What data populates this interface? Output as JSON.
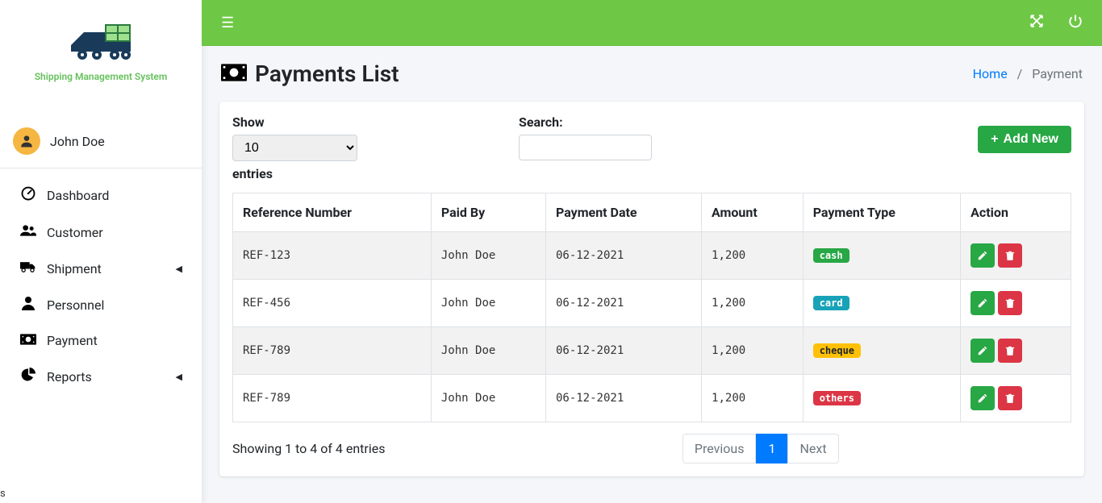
{
  "app": {
    "name": "Shipping Management System"
  },
  "user": {
    "name": "John Doe"
  },
  "sidebar": {
    "items": [
      {
        "label": "Dashboard",
        "icon": "dashboard-icon"
      },
      {
        "label": "Customer",
        "icon": "users-icon"
      },
      {
        "label": "Shipment",
        "icon": "truck-icon",
        "chevron": true
      },
      {
        "label": "Personnel",
        "icon": "user-icon"
      },
      {
        "label": "Payment",
        "icon": "money-icon"
      },
      {
        "label": "Reports",
        "icon": "chart-icon",
        "chevron": true
      }
    ]
  },
  "page": {
    "title": "Payments List"
  },
  "breadcrumb": {
    "home": "Home",
    "current": "Payment"
  },
  "datatable": {
    "show_label": "Show",
    "entries_label": "entries",
    "show_value": "10",
    "search_label": "Search:",
    "add_label": "Add New",
    "headers": [
      "Reference Number",
      "Paid By",
      "Payment Date",
      "Amount",
      "Payment Type",
      "Action"
    ],
    "rows": [
      {
        "ref": "REF-123",
        "paid_by": "John Doe",
        "date": "06-12-2021",
        "amount": "1,200",
        "type": "cash",
        "type_class": "badge-success"
      },
      {
        "ref": "REF-456",
        "paid_by": "John Doe",
        "date": "06-12-2021",
        "amount": "1,200",
        "type": "card",
        "type_class": "badge-info"
      },
      {
        "ref": "REF-789",
        "paid_by": "John Doe",
        "date": "06-12-2021",
        "amount": "1,200",
        "type": "cheque",
        "type_class": "badge-warning"
      },
      {
        "ref": "REF-789",
        "paid_by": "John Doe",
        "date": "06-12-2021",
        "amount": "1,200",
        "type": "others",
        "type_class": "badge-danger"
      }
    ],
    "footer_info": "Showing 1 to 4 of 4 entries",
    "pagination": {
      "prev": "Previous",
      "page": "1",
      "next": "Next"
    }
  }
}
